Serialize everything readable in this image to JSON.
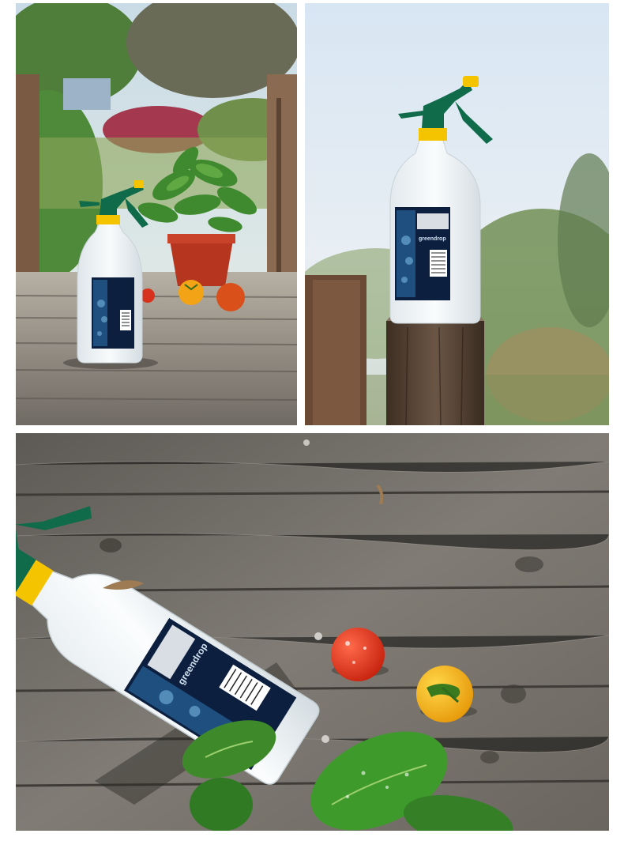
{
  "photos": [
    {
      "id": "photo-top-left",
      "subject": "spray-bottle-on-deck-with-potted-plant"
    },
    {
      "id": "photo-top-right",
      "subject": "spray-bottle-on-wooden-post"
    },
    {
      "id": "photo-bottom",
      "subject": "spray-bottle-lying-on-wooden-planks"
    }
  ],
  "product_label": {
    "brand": "greendrop"
  },
  "colors": {
    "nozzle_green": "#0f6b4a",
    "collar_yellow": "#f5c400",
    "bottle_white": "#eef2f4",
    "label_navy": "#0c1f3f",
    "wood_grey": "#7d7a74",
    "sky_blue": "#d8e6f3"
  }
}
